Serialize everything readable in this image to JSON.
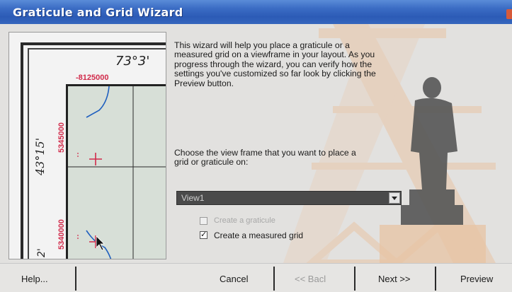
{
  "window": {
    "title": "Graticule and Grid Wizard"
  },
  "preview": {
    "longitude_label": "73°3'",
    "latitude_label": "43°15'",
    "easting_label": "-8125000",
    "northing_labels": [
      "5345000",
      "5340000"
    ],
    "corner_label": "2'"
  },
  "content": {
    "description": "This wizard will help you place a graticule or a measured grid on a viewframe in your layout. As you progress through the wizard, you can verify how the settings you've customized so far look by clicking the Preview button.",
    "choose_label": "Choose the view frame that you want to place a grid or graticule on:",
    "view_select": {
      "value": "View1"
    },
    "options": {
      "create_graticule": {
        "label": "Create a graticule",
        "checked": false,
        "enabled": false
      },
      "create_grid": {
        "label": "Create a measured grid",
        "checked": true,
        "enabled": true
      }
    }
  },
  "footer": {
    "help_label": "Help...",
    "cancel_label": "Cancel",
    "back_label": "<< Bacl",
    "next_label": "Next >>",
    "preview_label": "Preview"
  },
  "colors": {
    "title_bar": "#3566bd",
    "grid_label": "#d12a4a",
    "river": "#1f5fbf",
    "select_background": "#4a4a4a"
  }
}
